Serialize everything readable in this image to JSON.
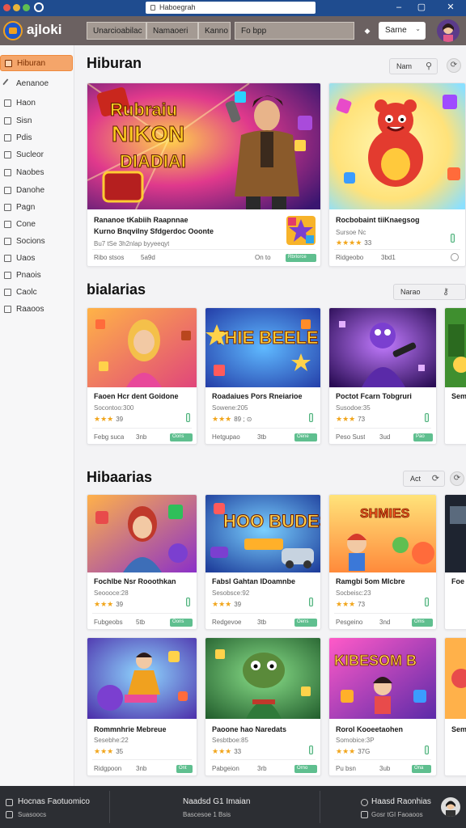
{
  "window": {
    "address": "Haboegrah",
    "colors": {
      "titlebar": "#1f4c8f",
      "header": "#6b6161",
      "accent": "#f4a56a"
    }
  },
  "header": {
    "logo_text": "ajloki",
    "segments": [
      "Unarcioabilac",
      "Namaoeri",
      "Kanno",
      "Fo bpp"
    ],
    "sort_label": "Sarne",
    "nav_icon": "chevron-right-icon"
  },
  "sidebar": {
    "items": [
      {
        "label": "Hiburan",
        "active": true
      },
      {
        "label": "Aenanoe"
      },
      {
        "label": "Haon"
      },
      {
        "label": "Sisn"
      },
      {
        "label": "Pdis"
      },
      {
        "label": "Sucleor"
      },
      {
        "label": "Naobes"
      },
      {
        "label": "Danohe"
      },
      {
        "label": "Pagn"
      },
      {
        "label": "Cone"
      },
      {
        "label": "Socions"
      },
      {
        "label": "Uaos"
      },
      {
        "label": "Pnaois"
      },
      {
        "label": "Caolc"
      },
      {
        "label": "Raaoos"
      }
    ]
  },
  "sections": [
    {
      "title": "Hiburan",
      "control_label": "Nam",
      "featured": {
        "banner_text": [
          "Rubraiu",
          "NIKON",
          "DIADIAI"
        ],
        "title": "Rananoe tKabiih Raapnnae",
        "subtitle": "Kurno Bnqvilny Sfdgerdoc Ooonte",
        "line": "Bu7 tSe 3h2nlap byyeeqyt",
        "meta_left": "Ribo stsos",
        "meta_mid": "5a9d",
        "meta_right": "On to",
        "tag": "Rbrlorce"
      },
      "side_card": {
        "title": "Rocbobaint tiiKnaegsog",
        "subtitle": "Sursoe Nc",
        "rating_num": "33",
        "meta_left": "Ridgeobo",
        "meta_mid": "3bd1"
      }
    },
    {
      "title": "bialarias",
      "control_label": "Narao",
      "cards": [
        {
          "title": "Faoen Hcr dent Goidone",
          "subtitle": "Socontoo:300",
          "rating_num": "39",
          "meta_left": "Febg suca",
          "meta_mid": "3nb",
          "tag": "Oons"
        },
        {
          "title": "Roadaiues Pors Rneiarioe",
          "subtitle": "Sowene:205",
          "rating_num": "89 ; ⊙",
          "meta_left": "Hetgupao",
          "meta_mid": "3tb",
          "tag": "Oene"
        },
        {
          "title": "Poctot Fcarn Tobgruri",
          "subtitle": "Susodoe:35",
          "rating_num": "73",
          "meta_left": "Peso Sust",
          "meta_mid": "3ud",
          "tag": "Pao"
        },
        {
          "title": "Sem",
          "subtitle": "",
          "rating_num": "",
          "meta_left": "",
          "meta_mid": "",
          "tag": ""
        }
      ],
      "banner_text": "THIE BEELE"
    },
    {
      "title": "Hibaarias",
      "control_label": "Act",
      "cards": [
        {
          "title": "Fochlbe Nsr Rooothkan",
          "subtitle": "Seoooce:28",
          "rating_num": "39",
          "meta_left": "Fubgeobs",
          "meta_mid": "5tb",
          "tag": "Oons"
        },
        {
          "title": "Fabsl Gahtan IDoamnbe",
          "subtitle": "Sesobsce:92",
          "rating_num": "39",
          "meta_left": "Redgevoe",
          "meta_mid": "3tb",
          "tag": "Oens"
        },
        {
          "title": "Ramgbi 5om Mlcbre",
          "subtitle": "Socbeisc:23",
          "rating_num": "73",
          "meta_left": "Pesgeino",
          "meta_mid": "3nd",
          "tag": "Oms"
        },
        {
          "title": "Foe",
          "subtitle": "",
          "rating_num": "",
          "meta_left": "",
          "meta_mid": "",
          "tag": ""
        },
        {
          "title": "Rommnhrie Mebreue",
          "subtitle": "Sesebhe:22",
          "rating_num": "35",
          "meta_left": "Ridgpoon",
          "meta_mid": "3nb",
          "tag": "Ont"
        },
        {
          "title": "Paoone hao Naredats",
          "subtitle": "Sesbtboe:85",
          "rating_num": "33",
          "meta_left": "Pabgeion",
          "meta_mid": "3rb",
          "tag": "Orno"
        },
        {
          "title": "Rorol Kooeetaohen",
          "subtitle": "Somobice:3P",
          "rating_num": "37G",
          "meta_left": "Pu bsn",
          "meta_mid": "3ub",
          "tag": "Ona"
        },
        {
          "title": "Sem",
          "subtitle": "",
          "rating_num": "",
          "meta_left": "",
          "meta_mid": "",
          "tag": ""
        }
      ],
      "banner_texts": [
        "HOO BUDES",
        "SHMIES",
        "KIBESOM B"
      ]
    }
  ],
  "footer": {
    "left_title": "Hocnas Faotuomico",
    "left_sub": "Suasoocs",
    "mid_title": "Naadsd G1 Imaian",
    "mid_sub": "Bascesoe 1 Bsis",
    "right_title": "Haasd Raonhias",
    "right_sub": "Gosr tGI Faoaoos"
  }
}
